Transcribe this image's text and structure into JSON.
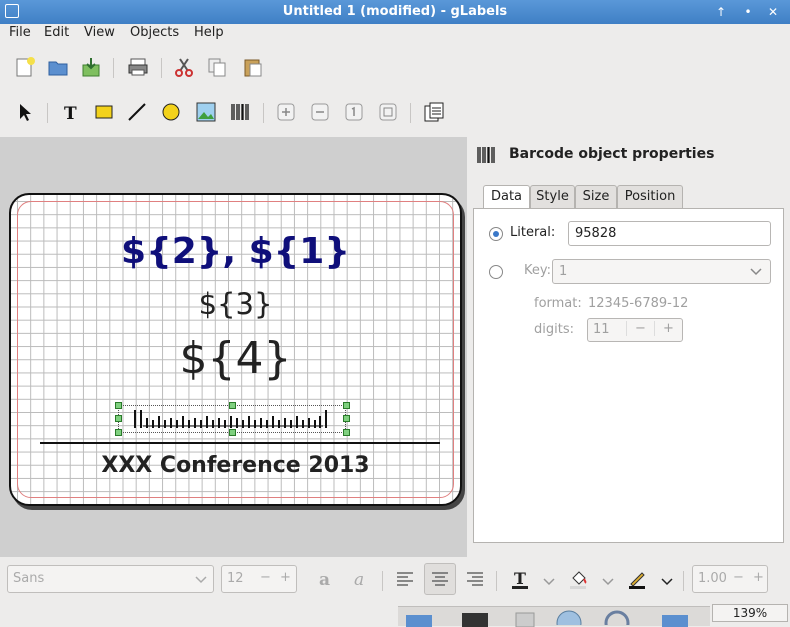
{
  "window": {
    "title": "Untitled 1 (modified) - gLabels",
    "up": "↑",
    "minimize": "•",
    "close": "✕"
  },
  "menu": {
    "file": "File",
    "edit": "Edit",
    "view": "View",
    "objects": "Objects",
    "help": "Help"
  },
  "label": {
    "line1": "${2}, ${1}",
    "line2": "${3}",
    "line3": "${4}",
    "footer": "XXX Conference 2013"
  },
  "colors": {
    "name_text": "#0f0f7a",
    "titlebar": "#4a8bd0",
    "radio": "#3a78c8",
    "grid_margin": "#e08080"
  },
  "properties": {
    "heading": "Barcode object properties",
    "tabs": [
      "Data",
      "Style",
      "Size",
      "Position"
    ],
    "active_tab": "Data",
    "literal_label": "Literal:",
    "literal_value": "95828",
    "key_label": "Key:",
    "key_value": "1",
    "format_label": "format:",
    "format_value": "12345-6789-12",
    "digits_label": "digits:",
    "digits_value": "11",
    "minus": "−",
    "plus": "+"
  },
  "textbar": {
    "font": "Sans",
    "size": "12",
    "minus": "−",
    "plus": "+",
    "line_spacing": "1.00"
  },
  "status": {
    "zoom": "139%"
  },
  "icons": [
    "new-icon",
    "open-icon",
    "save-icon",
    "print-icon",
    "cut-icon",
    "copy-icon",
    "paste-icon",
    "pointer-icon",
    "text-icon",
    "box-icon",
    "line-icon",
    "ellipse-icon",
    "image-icon",
    "barcode-icon",
    "zoom-in-icon",
    "zoom-out-icon",
    "zoom-1to1-icon",
    "zoom-fit-icon",
    "merge-properties-icon"
  ]
}
